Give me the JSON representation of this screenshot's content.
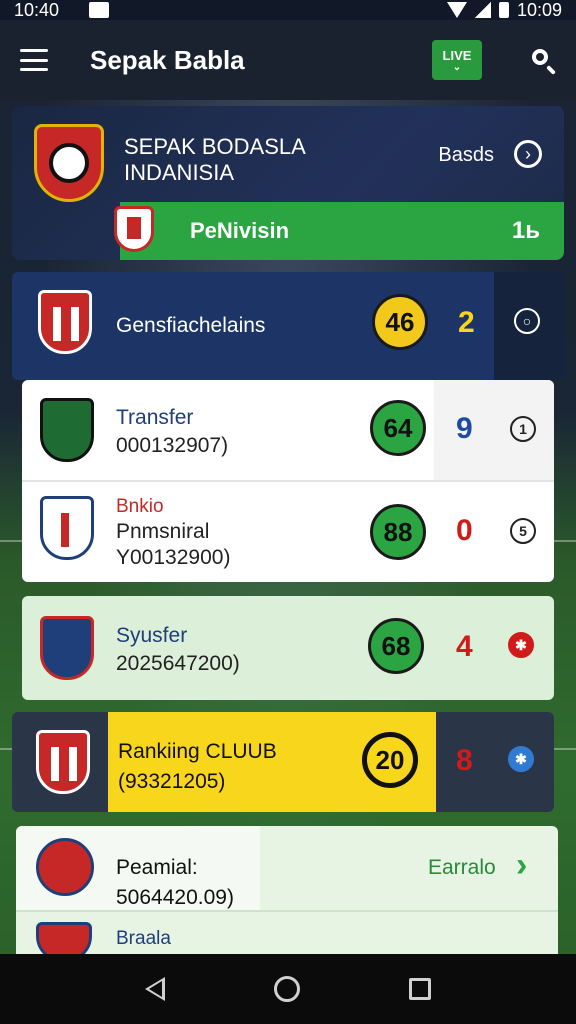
{
  "statusbar": {
    "time_left": "10:40",
    "time_right": "10:09"
  },
  "appbar": {
    "title": "Sepak Babla",
    "badge": "LIVE",
    "badge_sub": "⌄"
  },
  "hero": {
    "title_line1": "SEPAK BODASLA",
    "title_line2": "INDANISIA",
    "link": "Basds",
    "bar_label": "PeNivisin",
    "bar_value": "1ь"
  },
  "rows": [
    {
      "title": "Gensfiachelains",
      "score": "46",
      "rank": "2",
      "icon": "○"
    },
    {
      "title": "Transfer",
      "sub": "000132907)",
      "score": "64",
      "rank": "9",
      "icon": "1"
    },
    {
      "title": "Bnkio",
      "title2": "Pnmsniral",
      "sub": "Y00132900)",
      "score": "88",
      "rank": "0",
      "icon": "5"
    },
    {
      "title": "Syusfer",
      "sub": "2025647200)",
      "score": "68",
      "rank": "4",
      "icon": "✱"
    },
    {
      "title": "Rankiing CLUUB",
      "sub": "(93321205)",
      "score": "20",
      "rank": "8",
      "icon": "✱"
    },
    {
      "title": "Peamial:",
      "sub": "5064420.09)",
      "link": "Earralo",
      "arrow": "›"
    },
    {
      "title": "Braala"
    }
  ],
  "colors": {
    "green": "#2aa542",
    "blue_rank": "#1f4aa0",
    "red_rank": "#d11a1a",
    "yellow": "#f7d61c"
  }
}
